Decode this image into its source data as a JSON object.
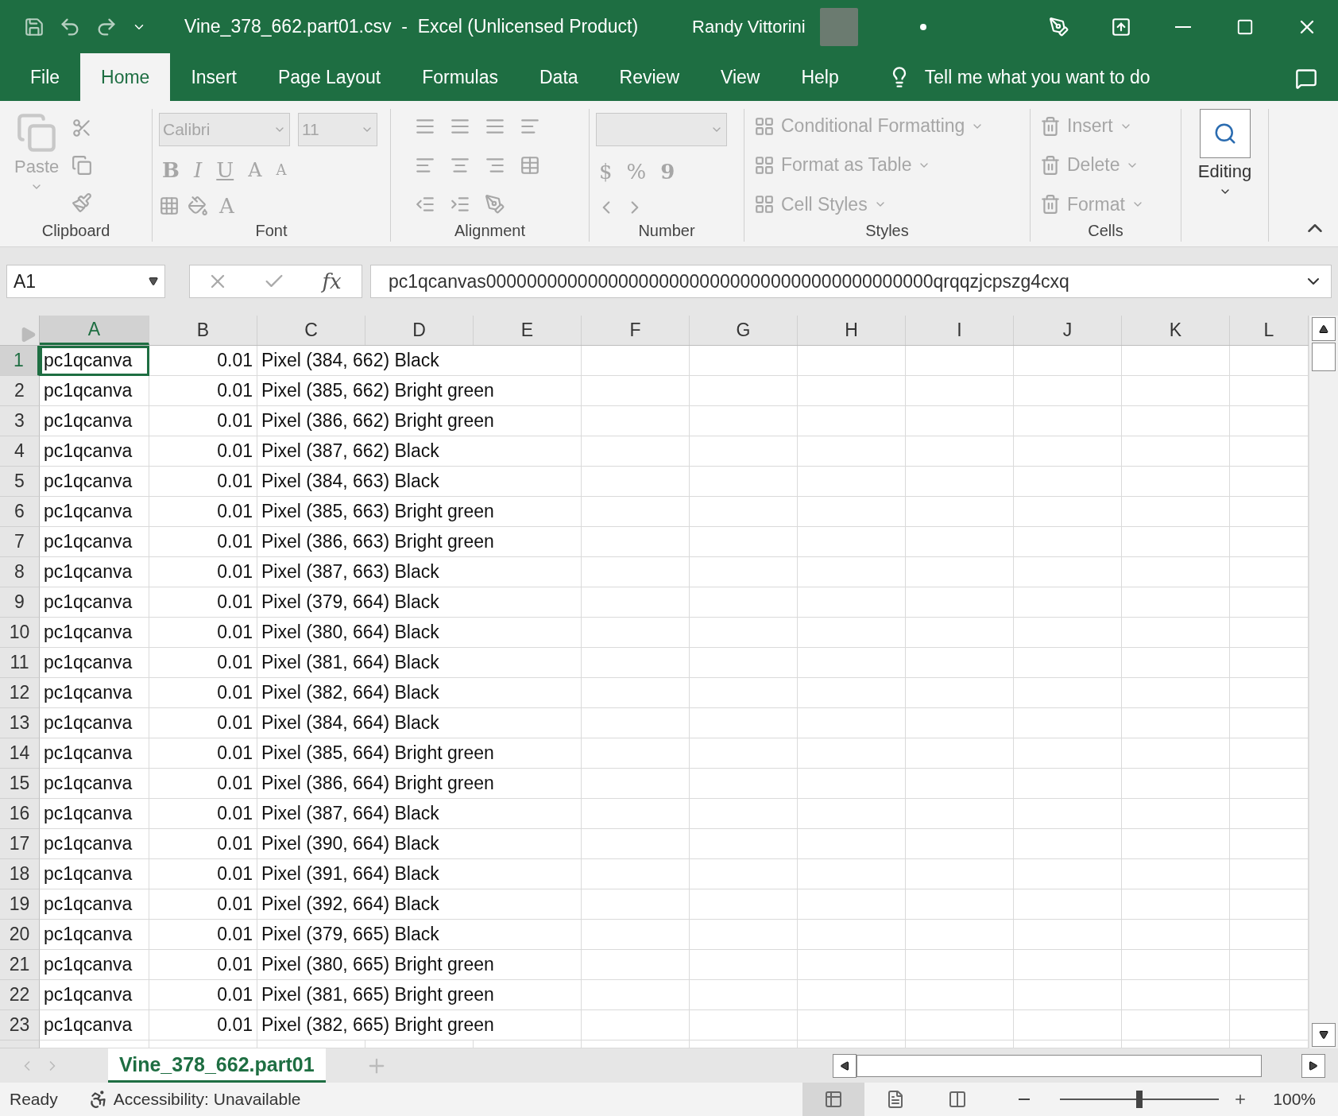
{
  "title_bar": {
    "title": "Vine_378_662.part01.csv  -  Excel (Unlicensed Product)",
    "user": "Randy Vittorini"
  },
  "menu_tabs": [
    {
      "label": "File",
      "selected": false
    },
    {
      "label": "Home",
      "selected": true
    },
    {
      "label": "Insert",
      "selected": false
    },
    {
      "label": "Page Layout",
      "selected": false
    },
    {
      "label": "Formulas",
      "selected": false
    },
    {
      "label": "Data",
      "selected": false
    },
    {
      "label": "Review",
      "selected": false
    },
    {
      "label": "View",
      "selected": false
    },
    {
      "label": "Help",
      "selected": false
    }
  ],
  "tell_me": "Tell me what you want to do",
  "ribbon": {
    "disabled": true,
    "clipboard": {
      "paste": "Paste",
      "label": "Clipboard"
    },
    "font": {
      "font_name": "Calibri",
      "font_size": "11",
      "bold": "B",
      "italic": "I",
      "underline": "U",
      "grow": "A",
      "shrink": "A",
      "font_color_letter": "A",
      "label": "Font"
    },
    "alignment": {
      "label": "Alignment"
    },
    "number": {
      "currency": "$",
      "percent": "%",
      "comma": "9",
      "label": "Number"
    },
    "styles": {
      "items": [
        "Conditional Formatting",
        "Format as Table",
        "Cell Styles"
      ],
      "label": "Styles"
    },
    "cells": {
      "items": [
        "Insert",
        "Delete",
        "Format"
      ],
      "label": "Cells"
    },
    "editing": {
      "label": "Editing"
    }
  },
  "formula_bar": {
    "name_box": "A1",
    "function_button": "fx",
    "formula": "pc1qcanvas00000000000000000000000000000000000000000000qrqqzjcpszg4cxq"
  },
  "columns": [
    {
      "label": "A",
      "selected": true
    },
    {
      "label": "B",
      "selected": false
    },
    {
      "label": "C",
      "selected": false
    },
    {
      "label": "D",
      "selected": false
    },
    {
      "label": "E",
      "selected": false
    },
    {
      "label": "F",
      "selected": false
    },
    {
      "label": "G",
      "selected": false
    },
    {
      "label": "H",
      "selected": false
    },
    {
      "label": "I",
      "selected": false
    },
    {
      "label": "J",
      "selected": false
    },
    {
      "label": "K",
      "selected": false
    },
    {
      "label": "L",
      "selected": false
    }
  ],
  "rows": [
    {
      "header": "1",
      "selected": true,
      "a": "pc1qcanva",
      "b": "0.01",
      "c": "Pixel (384, 662) Black"
    },
    {
      "header": "2",
      "selected": false,
      "a": "pc1qcanva",
      "b": "0.01",
      "c": "Pixel (385, 662) Bright green"
    },
    {
      "header": "3",
      "selected": false,
      "a": "pc1qcanva",
      "b": "0.01",
      "c": "Pixel (386, 662) Bright green"
    },
    {
      "header": "4",
      "selected": false,
      "a": "pc1qcanva",
      "b": "0.01",
      "c": "Pixel (387, 662) Black"
    },
    {
      "header": "5",
      "selected": false,
      "a": "pc1qcanva",
      "b": "0.01",
      "c": "Pixel (384, 663) Black"
    },
    {
      "header": "6",
      "selected": false,
      "a": "pc1qcanva",
      "b": "0.01",
      "c": "Pixel (385, 663) Bright green"
    },
    {
      "header": "7",
      "selected": false,
      "a": "pc1qcanva",
      "b": "0.01",
      "c": "Pixel (386, 663) Bright green"
    },
    {
      "header": "8",
      "selected": false,
      "a": "pc1qcanva",
      "b": "0.01",
      "c": "Pixel (387, 663) Black"
    },
    {
      "header": "9",
      "selected": false,
      "a": "pc1qcanva",
      "b": "0.01",
      "c": "Pixel (379, 664) Black"
    },
    {
      "header": "10",
      "selected": false,
      "a": "pc1qcanva",
      "b": "0.01",
      "c": "Pixel (380, 664) Black"
    },
    {
      "header": "11",
      "selected": false,
      "a": "pc1qcanva",
      "b": "0.01",
      "c": "Pixel (381, 664) Black"
    },
    {
      "header": "12",
      "selected": false,
      "a": "pc1qcanva",
      "b": "0.01",
      "c": "Pixel (382, 664) Black"
    },
    {
      "header": "13",
      "selected": false,
      "a": "pc1qcanva",
      "b": "0.01",
      "c": "Pixel (384, 664) Black"
    },
    {
      "header": "14",
      "selected": false,
      "a": "pc1qcanva",
      "b": "0.01",
      "c": "Pixel (385, 664) Bright green"
    },
    {
      "header": "15",
      "selected": false,
      "a": "pc1qcanva",
      "b": "0.01",
      "c": "Pixel (386, 664) Bright green"
    },
    {
      "header": "16",
      "selected": false,
      "a": "pc1qcanva",
      "b": "0.01",
      "c": "Pixel (387, 664) Black"
    },
    {
      "header": "17",
      "selected": false,
      "a": "pc1qcanva",
      "b": "0.01",
      "c": "Pixel (390, 664) Black"
    },
    {
      "header": "18",
      "selected": false,
      "a": "pc1qcanva",
      "b": "0.01",
      "c": "Pixel (391, 664) Black"
    },
    {
      "header": "19",
      "selected": false,
      "a": "pc1qcanva",
      "b": "0.01",
      "c": "Pixel (392, 664) Black"
    },
    {
      "header": "20",
      "selected": false,
      "a": "pc1qcanva",
      "b": "0.01",
      "c": "Pixel (379, 665) Black"
    },
    {
      "header": "21",
      "selected": false,
      "a": "pc1qcanva",
      "b": "0.01",
      "c": "Pixel (380, 665) Bright green"
    },
    {
      "header": "22",
      "selected": false,
      "a": "pc1qcanva",
      "b": "0.01",
      "c": "Pixel (381, 665) Bright green"
    },
    {
      "header": "23",
      "selected": false,
      "a": "pc1qcanva",
      "b": "0.01",
      "c": "Pixel (382, 665) Bright green"
    }
  ],
  "sheet_tabs": [
    {
      "label": "Vine_378_662.part01",
      "selected": true
    }
  ],
  "status_bar": {
    "status": "Ready",
    "accessibility": "Accessibility: Unavailable",
    "views": [
      {
        "selected": true
      },
      {
        "selected": false
      },
      {
        "selected": false
      }
    ],
    "zoom": {
      "level": 0.5,
      "reading": "100%"
    }
  }
}
